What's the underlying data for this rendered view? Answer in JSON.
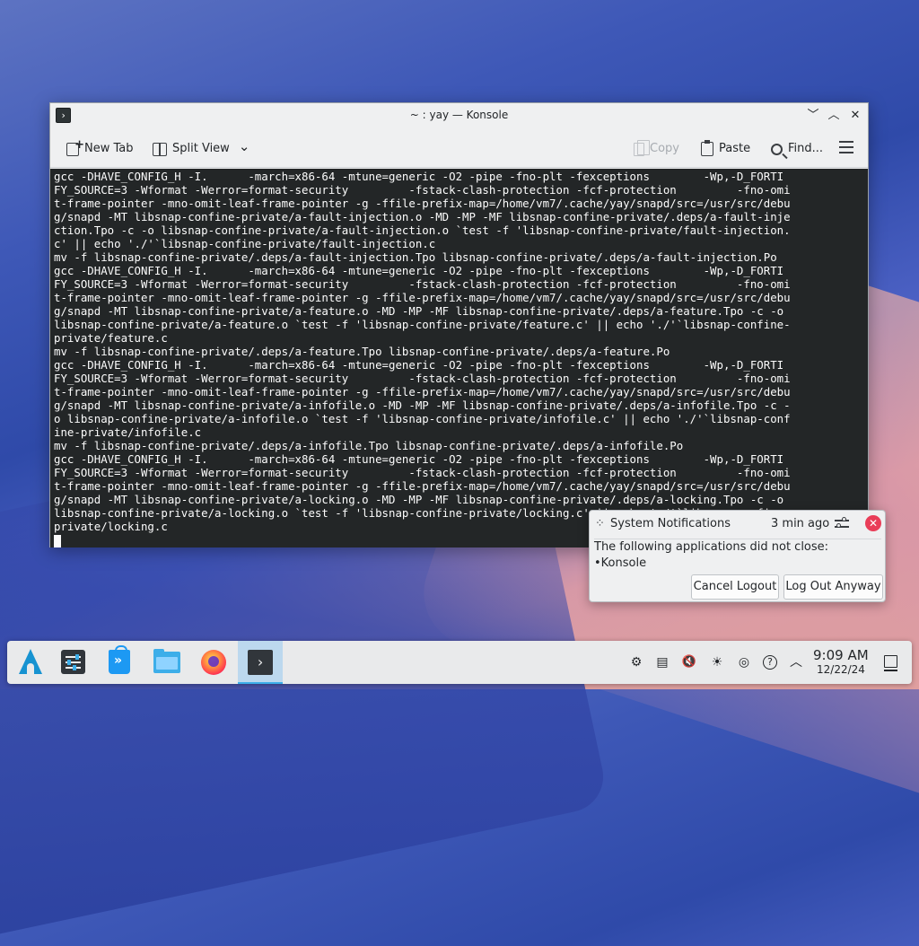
{
  "window": {
    "title": "~ : yay — Konsole",
    "app_icon_glyph": "›",
    "controls": {
      "minimize": "﹀",
      "maximize": "︿",
      "close": "✕"
    }
  },
  "toolbar": {
    "new_tab": "New Tab",
    "split_view": "Split View",
    "split_view_chevron": "⌄",
    "copy": "Copy",
    "paste": "Paste",
    "find": "Find..."
  },
  "terminal": {
    "lines": [
      "gcc -DHAVE_CONFIG_H -I.      -march=x86-64 -mtune=generic -O2 -pipe -fno-plt -fexceptions        -Wp,-D_FORTI",
      "FY_SOURCE=3 -Wformat -Werror=format-security         -fstack-clash-protection -fcf-protection         -fno-omi",
      "t-frame-pointer -mno-omit-leaf-frame-pointer -g -ffile-prefix-map=/home/vm7/.cache/yay/snapd/src=/usr/src/debu",
      "g/snapd -MT libsnap-confine-private/a-fault-injection.o -MD -MP -MF libsnap-confine-private/.deps/a-fault-inje",
      "ction.Tpo -c -o libsnap-confine-private/a-fault-injection.o `test -f 'libsnap-confine-private/fault-injection.",
      "c' || echo './'`libsnap-confine-private/fault-injection.c",
      "mv -f libsnap-confine-private/.deps/a-fault-injection.Tpo libsnap-confine-private/.deps/a-fault-injection.Po",
      "gcc -DHAVE_CONFIG_H -I.      -march=x86-64 -mtune=generic -O2 -pipe -fno-plt -fexceptions        -Wp,-D_FORTI",
      "FY_SOURCE=3 -Wformat -Werror=format-security         -fstack-clash-protection -fcf-protection         -fno-omi",
      "t-frame-pointer -mno-omit-leaf-frame-pointer -g -ffile-prefix-map=/home/vm7/.cache/yay/snapd/src=/usr/src/debu",
      "g/snapd -MT libsnap-confine-private/a-feature.o -MD -MP -MF libsnap-confine-private/.deps/a-feature.Tpo -c -o",
      "libsnap-confine-private/a-feature.o `test -f 'libsnap-confine-private/feature.c' || echo './'`libsnap-confine-",
      "private/feature.c",
      "mv -f libsnap-confine-private/.deps/a-feature.Tpo libsnap-confine-private/.deps/a-feature.Po",
      "gcc -DHAVE_CONFIG_H -I.      -march=x86-64 -mtune=generic -O2 -pipe -fno-plt -fexceptions        -Wp,-D_FORTI",
      "FY_SOURCE=3 -Wformat -Werror=format-security         -fstack-clash-protection -fcf-protection         -fno-omi",
      "t-frame-pointer -mno-omit-leaf-frame-pointer -g -ffile-prefix-map=/home/vm7/.cache/yay/snapd/src=/usr/src/debu",
      "g/snapd -MT libsnap-confine-private/a-infofile.o -MD -MP -MF libsnap-confine-private/.deps/a-infofile.Tpo -c -",
      "o libsnap-confine-private/a-infofile.o `test -f 'libsnap-confine-private/infofile.c' || echo './'`libsnap-conf",
      "ine-private/infofile.c",
      "mv -f libsnap-confine-private/.deps/a-infofile.Tpo libsnap-confine-private/.deps/a-infofile.Po",
      "gcc -DHAVE_CONFIG_H -I.      -march=x86-64 -mtune=generic -O2 -pipe -fno-plt -fexceptions        -Wp,-D_FORTI",
      "FY_SOURCE=3 -Wformat -Werror=format-security         -fstack-clash-protection -fcf-protection         -fno-omi",
      "t-frame-pointer -mno-omit-leaf-frame-pointer -g -ffile-prefix-map=/home/vm7/.cache/yay/snapd/src=/usr/src/debu",
      "g/snapd -MT libsnap-confine-private/a-locking.o -MD -MP -MF libsnap-confine-private/.deps/a-locking.Tpo -c -o",
      "libsnap-confine-private/a-locking.o `test -f 'libsnap-confine-private/locking.c' || echo './'`libsnap-confine-",
      "private/locking.c"
    ]
  },
  "notification": {
    "app_name": "System Notifications",
    "time": "3 min ago",
    "message": "The following applications did not close:",
    "item": "•Konsole",
    "cancel_button": "Cancel Logout",
    "logout_button": "Log Out Anyway",
    "close_glyph": "✕",
    "icon_glyph": "⁘"
  },
  "taskbar": {
    "tasks": [
      "application-launcher-icon",
      "system-settings-icon",
      "discover-icon",
      "file-manager-icon",
      "firefox-icon",
      "konsole-icon"
    ],
    "active_task": "konsole",
    "konsole_glyph": "›",
    "tray": {
      "network_glyph": "⚙",
      "clipboard_glyph": "▤",
      "volume_glyph": "🔇",
      "brightness_glyph": "☀",
      "updates_glyph": "◎",
      "help_glyph": "?",
      "expand_glyph": "︿"
    },
    "clock_time": "9:09 AM",
    "clock_date": "12/22/24"
  },
  "colors": {
    "terminal_bg": "#232627",
    "terminal_fg": "#fcfcfc",
    "accent": "#3daee9",
    "close_red": "#e93d58"
  }
}
